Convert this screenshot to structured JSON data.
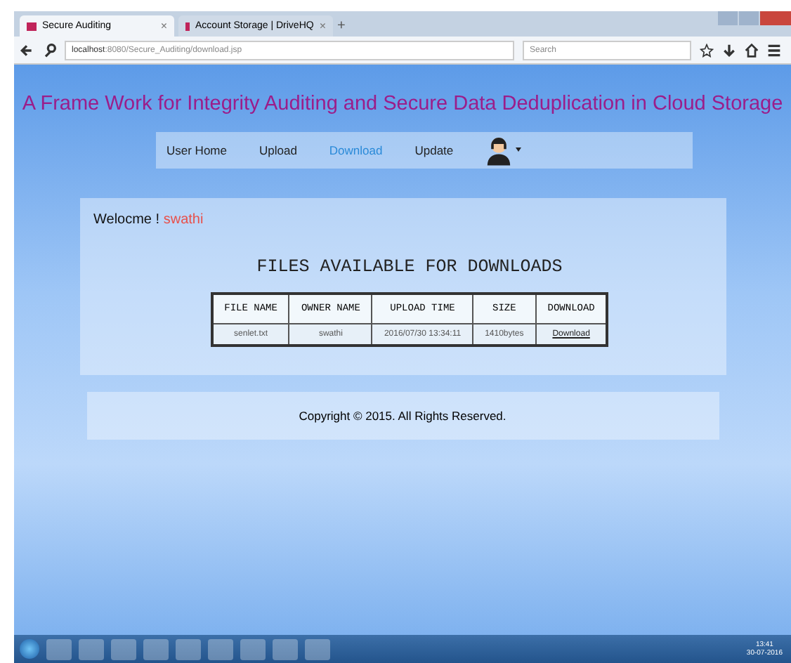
{
  "browser": {
    "tabs": [
      {
        "title": "Secure Auditing",
        "selected": true,
        "close": "×"
      },
      {
        "title": "Account Storage | DriveHQ",
        "selected": false,
        "close": "×"
      }
    ],
    "new_tab": "+",
    "url_host": "localhost",
    "url_path": ":8080/Secure_Auditing/download.jsp",
    "search_placeholder": "Search"
  },
  "page": {
    "title": "A Frame Work for Integrity Auditing and Secure Data Deduplication in Cloud Storage",
    "nav": [
      {
        "label": "User Home",
        "selected": false
      },
      {
        "label": "Upload",
        "selected": false
      },
      {
        "label": "Download",
        "selected": true
      },
      {
        "label": "Update",
        "selected": false
      }
    ],
    "welcome": "Welocme !",
    "user": "swathi",
    "heading": "FILES AVAILABLE FOR DOWNLOADS",
    "table": {
      "columns": [
        "FILE NAME",
        "OWNER NAME",
        "UPLOAD TIME",
        "SIZE",
        "DOWNLOAD"
      ],
      "rows": [
        {
          "cells": [
            "senlet.txt",
            "swathi",
            "2016/07/30 13:34:11",
            "1410bytes"
          ],
          "link": "Download"
        }
      ]
    },
    "footer": "Copyright © 2015. All Rights Reserved."
  },
  "taskbar": {
    "time": "13:41",
    "date": "30-07-2016"
  }
}
